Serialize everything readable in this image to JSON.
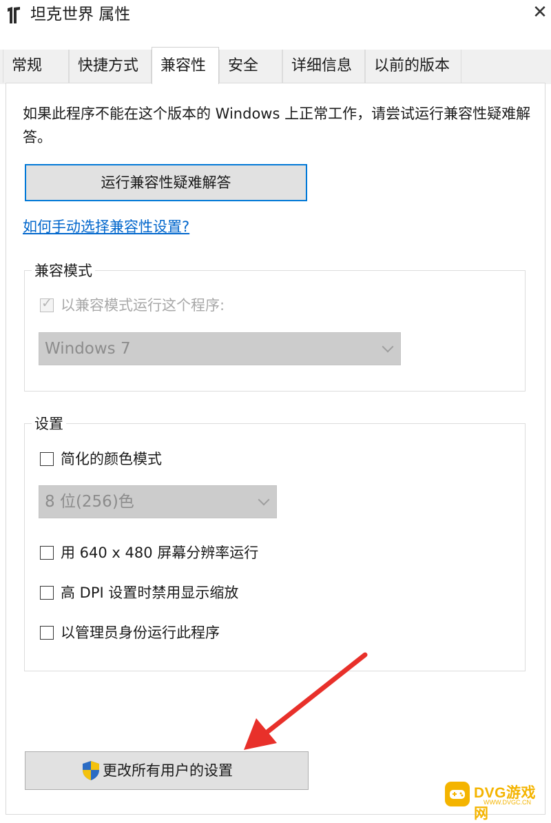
{
  "window": {
    "title": "坦克世界 属性",
    "close_glyph": "✕"
  },
  "tabs": [
    {
      "label": "常规"
    },
    {
      "label": "快捷方式"
    },
    {
      "label": "兼容性"
    },
    {
      "label": "安全"
    },
    {
      "label": "详细信息"
    },
    {
      "label": "以前的版本"
    }
  ],
  "active_tab": "兼容性",
  "compat": {
    "description": "如果此程序不能在这个版本的 Windows 上正常工作，请尝试运行兼容性疑难解答。",
    "troubleshoot_button": "运行兼容性疑难解答",
    "manual_link": "如何手动选择兼容性设置?"
  },
  "compat_mode": {
    "legend": "兼容模式",
    "checkbox_label": "以兼容模式运行这个程序:",
    "checked": true,
    "enabled": false,
    "os_select": "Windows 7"
  },
  "settings": {
    "legend": "设置",
    "reduced_color": {
      "label": "简化的颜色模式",
      "checked": false
    },
    "color_select": "8 位(256)色",
    "res_640": {
      "label": "用 640 x 480 屏幕分辨率运行",
      "checked": false
    },
    "high_dpi": {
      "label": "高 DPI 设置时禁用显示缩放",
      "checked": false
    },
    "run_admin": {
      "label": "以管理员身份运行此程序",
      "checked": false
    }
  },
  "all_users_button": "更改所有用户的设置",
  "watermark": {
    "text": "DVG游戏网",
    "sub": "WWW.DVGC.CN"
  },
  "colors": {
    "accent_border": "#0078d7",
    "link": "#0066cc",
    "annotation_arrow": "#e8302a",
    "watermark": "#f4b400"
  },
  "icons": [
    "app-icon",
    "close-icon",
    "checkmark-icon",
    "chevron-down-icon",
    "uac-shield-icon",
    "annotation-arrow"
  ]
}
